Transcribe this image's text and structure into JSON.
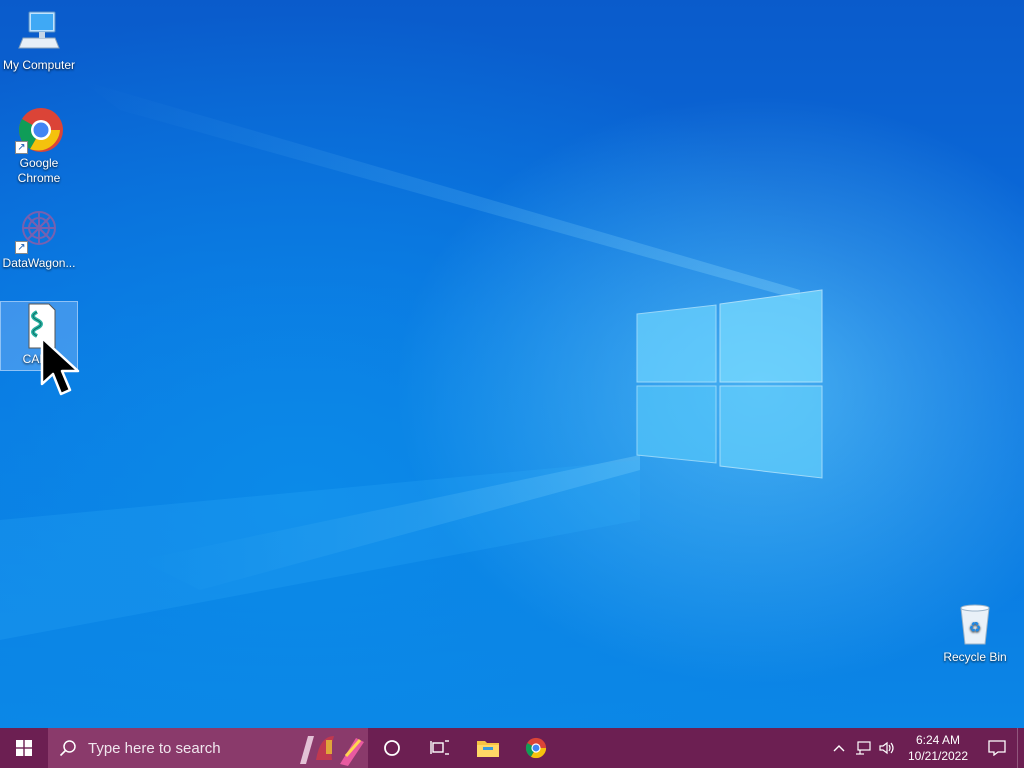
{
  "desktop": {
    "icons": [
      {
        "label": "My Computer"
      },
      {
        "label": "Google\nChrome"
      },
      {
        "label": "DataWagon..."
      },
      {
        "label": "CAPS"
      },
      {
        "label": "Recycle Bin"
      }
    ]
  },
  "taskbar": {
    "search_placeholder": "Type here to search",
    "pinned": [
      "task-view-icon",
      "file-explorer-icon",
      "chrome-icon"
    ],
    "clock": {
      "time": "6:24 AM",
      "date": "10/21/2022"
    }
  },
  "colors": {
    "taskbar": "#6c1f52",
    "search_box": "#8a3a6b",
    "desktop_blue": "#0a6fde"
  }
}
